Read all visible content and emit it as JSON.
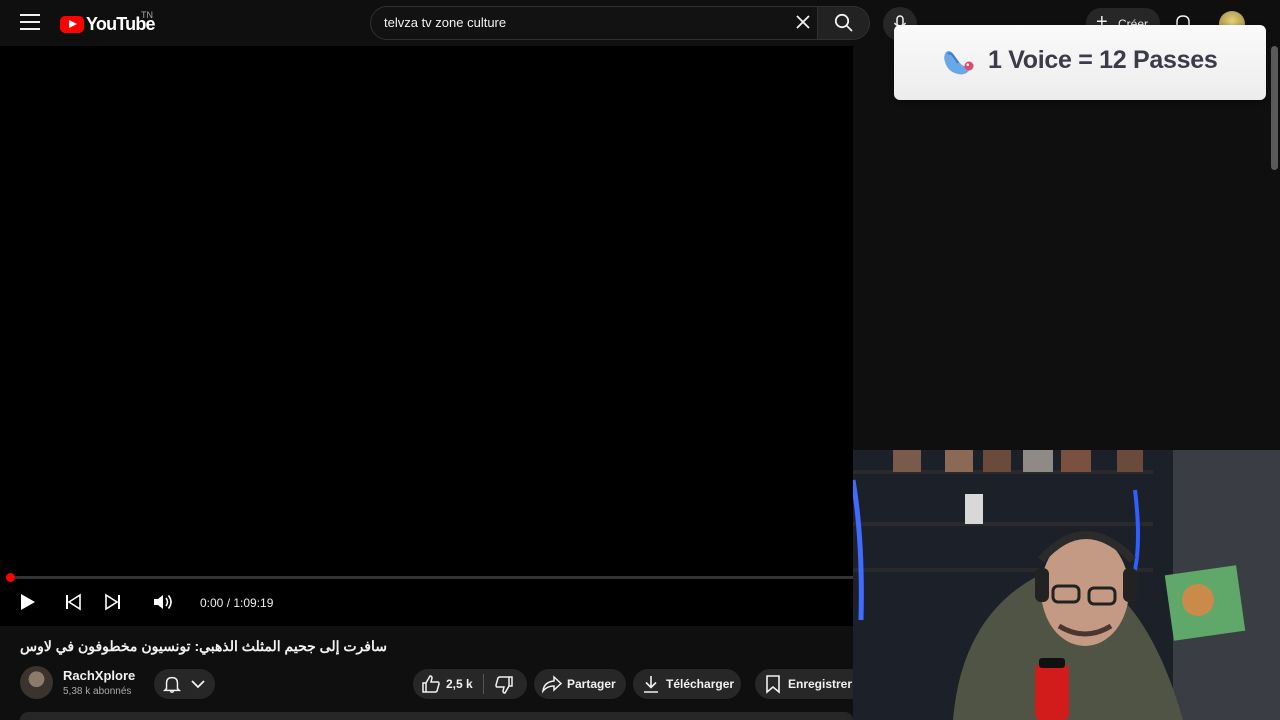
{
  "header": {
    "logo_text": "YouTube",
    "country_code": "TN",
    "search_value": "telvza tv zone culture",
    "create_label": "Créer"
  },
  "player": {
    "time_display": "0:00 / 1:09:19",
    "progress_fraction": 0.0
  },
  "video": {
    "title": "سافرت إلى جحيم المثلث الذهبي: تونسيون مخطوفون في لاوس",
    "channel_name": "RachXplore",
    "subscribers": "5,38 k abonnés"
  },
  "actions": {
    "like_count": "2,5 k",
    "share_label": "Partager",
    "download_label": "Télécharger",
    "save_label": "Enregistrer"
  },
  "overlay_banner": {
    "text": "1 Voice = 12 Passes"
  },
  "colors": {
    "background": "#0f0f0f",
    "accent": "#ff0000",
    "surface": "#272727"
  },
  "icons": [
    "menu-icon",
    "youtube-logo-icon",
    "clear-icon",
    "search-icon",
    "mic-icon",
    "plus-icon",
    "bell-icon",
    "play-icon",
    "previous-icon",
    "next-icon",
    "volume-icon",
    "notification-bell-icon",
    "chevron-down-icon",
    "like-icon",
    "dislike-icon",
    "share-icon",
    "download-icon",
    "save-icon"
  ]
}
